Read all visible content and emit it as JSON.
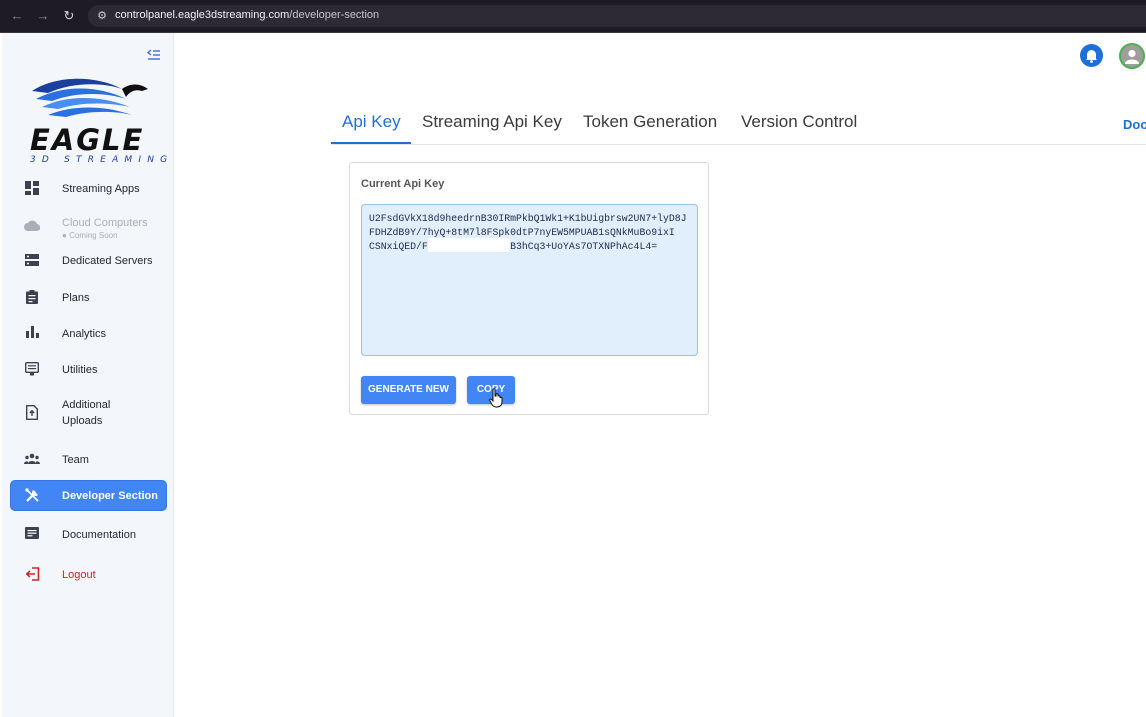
{
  "browser": {
    "url_domain": "controlpanel.eagle3dstreaming.com",
    "url_path": "/developer-section"
  },
  "sidebar": {
    "logo": {
      "word": "EAGLE",
      "sub": "3D STREAMING",
      "colors": [
        "#1c3f9c",
        "#2b6fe0",
        "#111111"
      ]
    },
    "items": [
      {
        "label": "Streaming Apps",
        "icon": "dashboard-icon"
      },
      {
        "label": "Cloud Computers",
        "sub": "Coming Soon",
        "icon": "cloud-icon",
        "disabled": true
      },
      {
        "label": "Dedicated Servers",
        "icon": "server-icon"
      },
      {
        "label": "Plans",
        "icon": "clipboard-icon"
      },
      {
        "label": "Analytics",
        "icon": "bar-chart-icon"
      },
      {
        "label": "Utilities",
        "icon": "monitor-icon"
      },
      {
        "label": "Additional Uploads",
        "icon": "upload-file-icon"
      },
      {
        "label": "Team",
        "icon": "team-icon"
      },
      {
        "label": "Developer Section",
        "icon": "tools-icon",
        "active": true
      },
      {
        "label": "Documentation",
        "icon": "document-icon"
      },
      {
        "label": "Logout",
        "icon": "logout-icon"
      }
    ]
  },
  "tabs": [
    {
      "label": "Api Key",
      "active": true
    },
    {
      "label": "Streaming Api Key"
    },
    {
      "label": "Token Generation"
    },
    {
      "label": "Version Control"
    }
  ],
  "doc_link": "Doc",
  "api_key": {
    "title": "Current Api Key",
    "value": "U2FsdGVkX18d9heedrnB30IRmPkbQ1Wk1+K1bUigbrsw2UN7+lyD8JFDHZdB9Y/7hyQ+8tM7l8FSpk0dtP7nyEW5MPUAB1sQNkMuBo9ixI            CSNxiQED/Feg9GchVegJm3E1B3hCq3+UoYAs7OTXNPhAc4L4=",
    "generate_label": "GENERATE NEW",
    "copy_label": "COPY"
  },
  "colors": {
    "accent": "#4285f4",
    "active_tab": "#1f6fd9",
    "logout": "#c62828"
  }
}
